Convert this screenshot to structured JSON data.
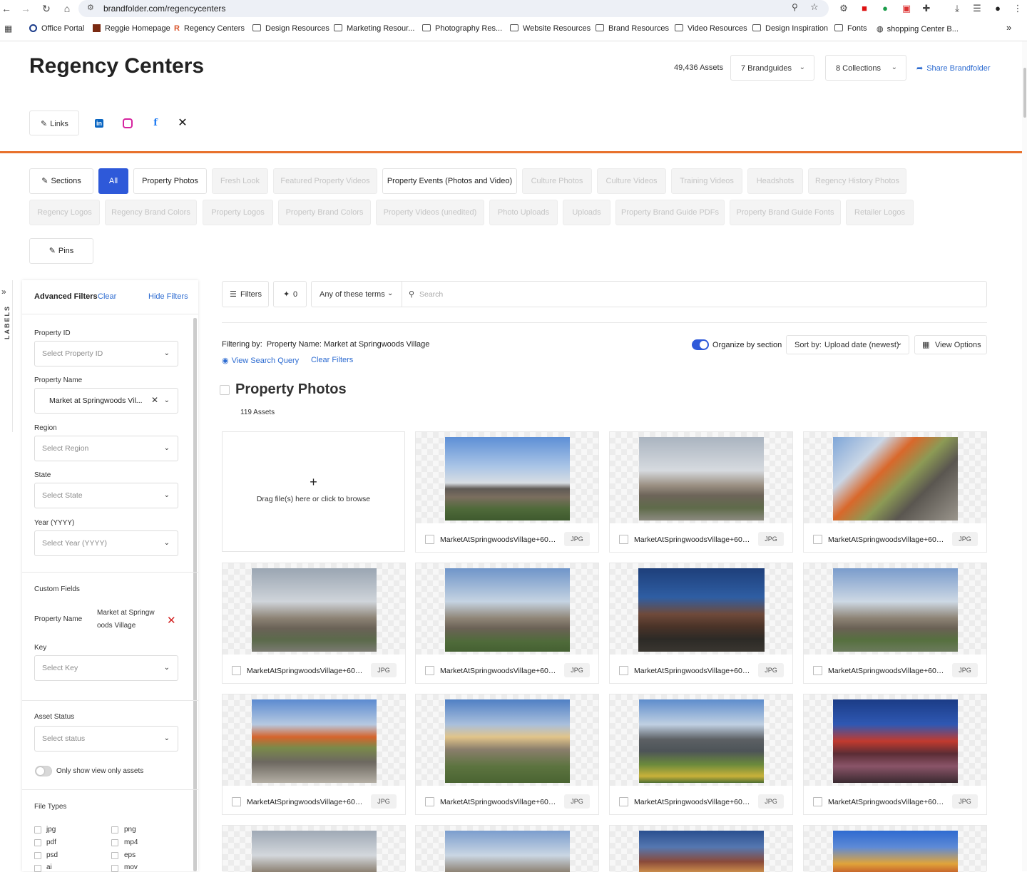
{
  "browser": {
    "url": "brandfolder.com/regencycenters",
    "bookmarks": [
      "Office Portal",
      "Reggie Homepage",
      "Regency Centers",
      "Design Resources",
      "Marketing Resour...",
      "Photography Res...",
      "Website Resources",
      "Brand Resources",
      "Video Resources",
      "Design Inspiration",
      "Fonts",
      "shopping Center B..."
    ],
    "more_bookmarks": "»"
  },
  "header": {
    "title": "Regency Centers",
    "asset_count": "49,436 Assets",
    "brandguides": "7 Brandguides",
    "collections": "8 Collections",
    "share": "Share Brandfolder",
    "links_label": "Links"
  },
  "sections": {
    "edit_label": "Sections",
    "tabs": [
      {
        "label": "All",
        "state": "active"
      },
      {
        "label": "Property Photos",
        "state": "enabled"
      },
      {
        "label": "Fresh Look",
        "state": "disabled"
      },
      {
        "label": "Featured Property Videos",
        "state": "disabled"
      },
      {
        "label": "Property Events (Photos and Video)",
        "state": "enabled"
      },
      {
        "label": "Culture Photos",
        "state": "disabled"
      },
      {
        "label": "Culture Videos",
        "state": "disabled"
      },
      {
        "label": "Training Videos",
        "state": "disabled"
      },
      {
        "label": "Headshots",
        "state": "disabled"
      },
      {
        "label": "Regency History Photos",
        "state": "disabled"
      },
      {
        "label": "Regency Logos",
        "state": "disabled"
      },
      {
        "label": "Regency Brand Colors",
        "state": "disabled"
      },
      {
        "label": "Property Logos",
        "state": "disabled"
      },
      {
        "label": "Property Brand Colors",
        "state": "disabled"
      },
      {
        "label": "Property Videos (unedited)",
        "state": "disabled"
      },
      {
        "label": "Photo Uploads",
        "state": "disabled"
      },
      {
        "label": "Uploads",
        "state": "disabled"
      },
      {
        "label": "Property Brand Guide PDFs",
        "state": "disabled"
      },
      {
        "label": "Property Brand Guide Fonts",
        "state": "disabled"
      },
      {
        "label": "Retailer Logos",
        "state": "disabled"
      }
    ],
    "pins_label": "Pins"
  },
  "labels_strip": "LABELS",
  "filters": {
    "title": "Advanced Filters",
    "clear": "Clear",
    "hide": "Hide Filters",
    "property_id": {
      "label": "Property ID",
      "placeholder": "Select Property ID"
    },
    "property_name": {
      "label": "Property Name",
      "value": "Market at Springwoods Vil..."
    },
    "region": {
      "label": "Region",
      "placeholder": "Select Region"
    },
    "state": {
      "label": "State",
      "placeholder": "Select State"
    },
    "year": {
      "label": "Year (YYYY)",
      "placeholder": "Select Year (YYYY)"
    },
    "custom_fields": "Custom Fields",
    "custom_name_label": "Property Name",
    "custom_name_value_1": "Market at Springw",
    "custom_name_value_2": "oods Village",
    "key": {
      "label": "Key",
      "placeholder": "Select Key"
    },
    "asset_status": {
      "label": "Asset Status",
      "placeholder": "Select status"
    },
    "view_only": "Only show view only assets",
    "file_types_label": "File Types",
    "file_types": [
      "jpg",
      "png",
      "pdf",
      "mp4",
      "psd",
      "eps",
      "ai",
      "mov"
    ]
  },
  "toolbar": {
    "filters": "Filters",
    "pins_count": "0",
    "terms": "Any of these terms",
    "search_placeholder": "Search",
    "filtering_by_label": "Filtering by:",
    "filtering_by_value": "Property Name: Market at Springwoods Village",
    "view_query": "View Search Query",
    "clear_filters": "Clear Filters",
    "organize": "Organize by section",
    "sort_label": "Sort by:",
    "sort_value": "Upload date (newest)",
    "view_options": "View Options"
  },
  "section": {
    "title": "Property Photos",
    "count": "119 Assets",
    "upload_text": "Drag file(s) here or click to browse"
  },
  "assets": [
    {
      "name": "MarketAtSpringwoodsVillage+607...",
      "type": "JPG"
    },
    {
      "name": "MarketAtSpringwoodsVillage+607...",
      "type": "JPG"
    },
    {
      "name": "MarketAtSpringwoodsVillage+607...",
      "type": "JPG"
    },
    {
      "name": "MarketAtSpringwoodsVillage+607...",
      "type": "JPG"
    },
    {
      "name": "MarketAtSpringwoodsVillage+607...",
      "type": "JPG"
    },
    {
      "name": "MarketAtSpringwoodsVillage+607...",
      "type": "JPG"
    },
    {
      "name": "MarketAtSpringwoodsVillage+607...",
      "type": "JPG"
    },
    {
      "name": "MarketAtSpringwoodsVillage+607...",
      "type": "JPG"
    },
    {
      "name": "MarketAtSpringwoodsVillage+607...",
      "type": "JPG"
    },
    {
      "name": "MarketAtSpringwoodsVillage+607...",
      "type": "JPG"
    },
    {
      "name": "MarketAtSpringwoodsVillage+607...",
      "type": "JPG"
    }
  ],
  "colors": {
    "accent": "#2e59d9",
    "link": "#2e6cd1",
    "rule": "#e8712c"
  }
}
